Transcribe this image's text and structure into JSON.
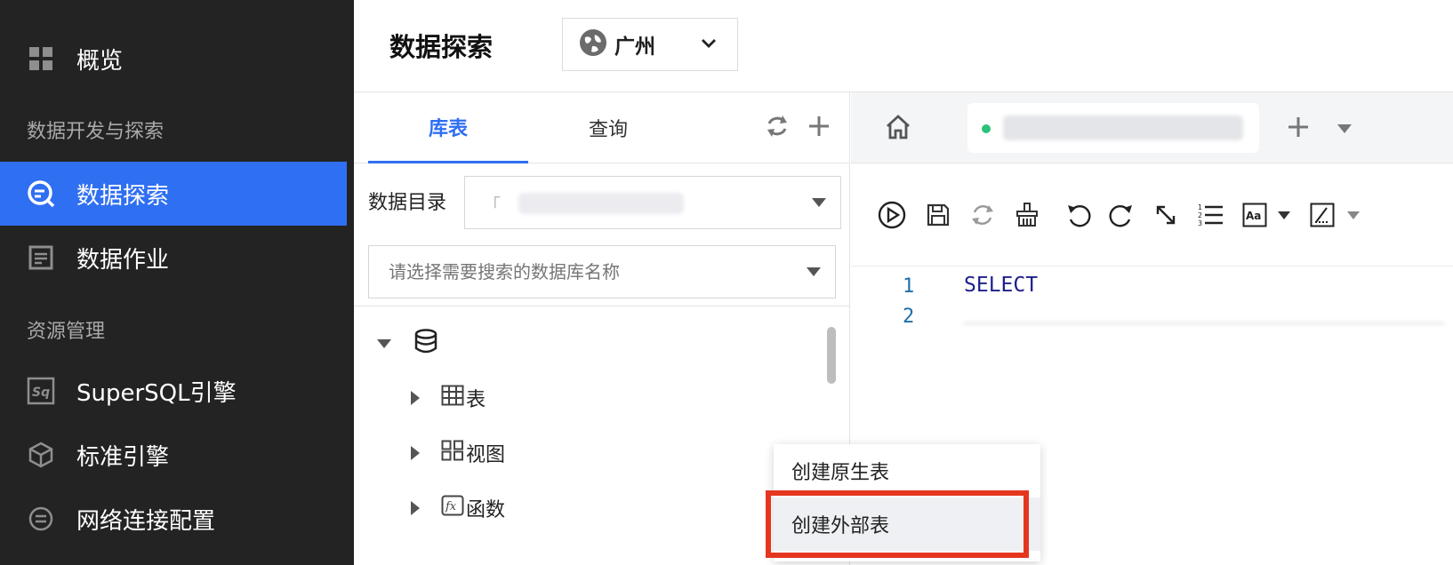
{
  "sidebar": {
    "overview_label": "概览",
    "section_dev": "数据开发与探索",
    "explore_label": "数据探索",
    "jobs_label": "数据作业",
    "section_resource": "资源管理",
    "supersql_label": "SuperSQL引擎",
    "standard_engine_label": "标准引擎",
    "network_label": "网络连接配置"
  },
  "header": {
    "title": "数据探索",
    "region": "广州"
  },
  "left_panel": {
    "tabs": [
      {
        "label": "库表"
      },
      {
        "label": "查询"
      }
    ],
    "catalog_label": "数据目录",
    "catalog_value_prefix": "「",
    "db_search_placeholder": "请选择需要搜索的数据库名称",
    "tree": {
      "table_label": "表",
      "view_label": "视图",
      "function_label": "函数"
    }
  },
  "editor": {
    "lines": [
      {
        "no": "1",
        "text": "SELECT"
      },
      {
        "no": "2",
        "text": ""
      }
    ]
  },
  "context_menu": {
    "items": [
      {
        "label": "创建原生表"
      },
      {
        "label": "创建外部表"
      }
    ]
  },
  "colors": {
    "accent": "#2f6ff2",
    "sidebar_bg": "#232323",
    "highlight_border": "#e5361f",
    "status_green": "#2bc27a"
  }
}
